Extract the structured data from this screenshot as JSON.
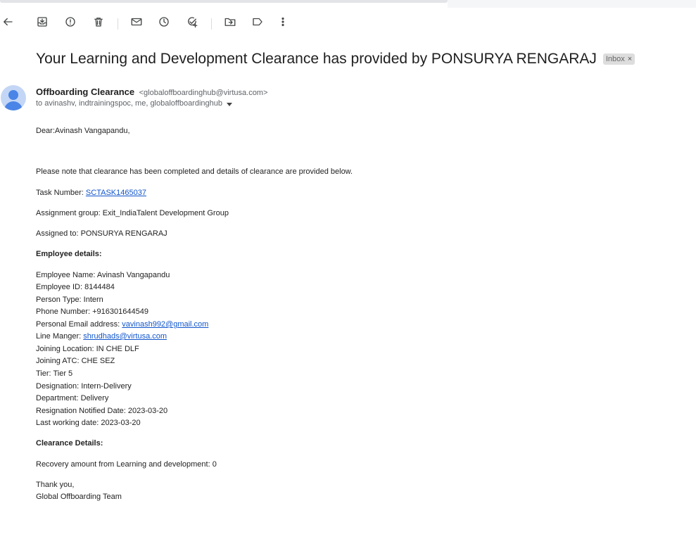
{
  "icons": {
    "back": "arrow-left-icon",
    "archive": "archive-icon",
    "spam": "report-spam-icon",
    "delete": "trash-icon",
    "unread": "mark-unread-icon",
    "snooze": "snooze-icon",
    "task": "add-task-icon",
    "move": "move-to-icon",
    "label": "label-icon",
    "more": "more-vert-icon"
  },
  "email": {
    "subject": "Your Learning and Development Clearance has provided by PONSURYA RENGARAJ",
    "label_chip": "Inbox",
    "chip_close": "×",
    "sender_name": "Offboarding Clearance",
    "sender_email": "<globaloffboardinghub@virtusa.com>",
    "recipients": "to avinashv, indtrainingspoc, me, globaloffboardinghub"
  },
  "body": {
    "greeting": "Dear:Avinash Vangapandu,",
    "intro": "Please note that clearance has been completed and details of clearance are provided below.",
    "task_label": "Task Number: ",
    "task_link": "SCTASK1465037",
    "assignment_group": "Assignment group: Exit_IndiaTalent Development Group",
    "assigned_to": "Assigned to: PONSURYA RENGARAJ",
    "employee_header": "Employee details:",
    "employee_name": "Employee Name: Avinash Vangapandu",
    "employee_id": "Employee ID: 8144484",
    "person_type": "Person Type: Intern",
    "phone": "Phone Number: +916301644549",
    "personal_email_label": "Personal Email address: ",
    "personal_email_link": "vavinash992@gmail.com",
    "line_manager_label": "Line Manger: ",
    "line_manager_link": "shrudhads@virtusa.com",
    "joining_location": "Joining Location: IN CHE DLF",
    "joining_atc": "Joining ATC: CHE SEZ",
    "tier": "Tier: Tier 5",
    "designation": "Designation: Intern-Delivery",
    "department": "Department: Delivery",
    "resignation_date": "Resignation Notified Date: 2023-03-20",
    "last_working_date": "Last working date: 2023-03-20",
    "clearance_header": "Clearance Details:",
    "recovery": "Recovery amount from Learning and development: 0",
    "thanks": "Thank you,",
    "signature": "Global Offboarding Team"
  }
}
